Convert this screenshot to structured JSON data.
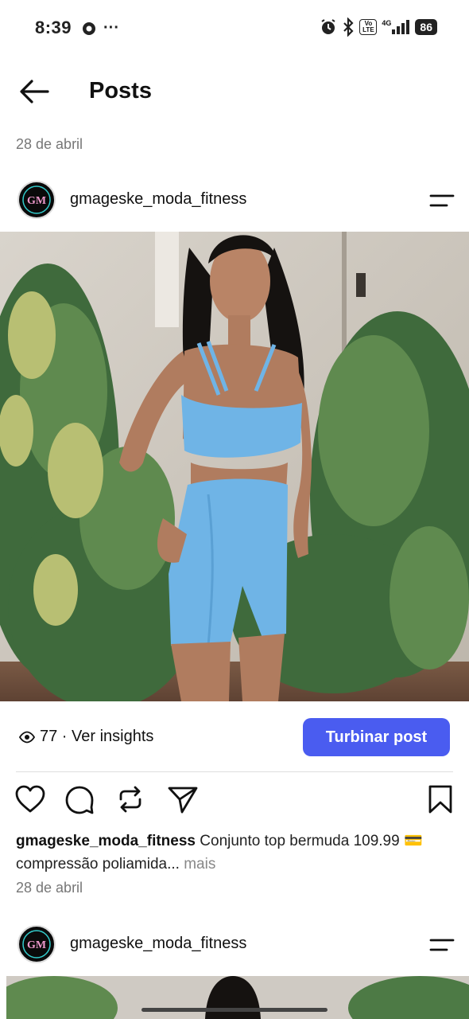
{
  "status_bar": {
    "time": "8:39",
    "more_dots": "···",
    "network": "4G",
    "volte": "Vo LTE",
    "battery": "86"
  },
  "header": {
    "title": "Posts"
  },
  "date_top": "28 de abril",
  "post": {
    "username": "gmageske_moda_fitness",
    "avatar_text": "GM",
    "views": "77 · Ver insights",
    "boost_label": "Turbinar post",
    "caption_user": "gmageske_moda_fitness",
    "caption_text": " Conjunto top bermuda 109.99 💳 compressão poliamida...",
    "more_label": " mais",
    "date": "28 de abril"
  },
  "next_post": {
    "username": "gmageske_moda_fitness",
    "avatar_text": "GM"
  },
  "icons": [
    "camera-icon",
    "alarm-icon",
    "bluetooth-icon",
    "signal-icon",
    "back-arrow-icon",
    "menu-icon",
    "eye-icon",
    "heart-icon",
    "comment-icon",
    "repost-icon",
    "share-icon",
    "bookmark-icon"
  ],
  "colors": {
    "accent": "#4a5cf0",
    "muted_text": "#777777",
    "outfit_blue": "#6fb4e6"
  }
}
